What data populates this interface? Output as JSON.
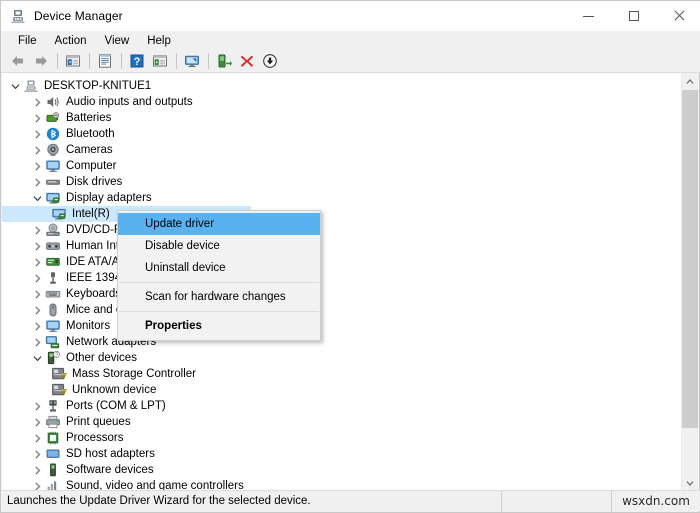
{
  "window": {
    "title": "Device Manager",
    "title_icon": "device-manager-icon",
    "caption": {
      "minimize": "minimize-button",
      "maximize": "maximize-button",
      "close": "close-button"
    }
  },
  "menubar": {
    "items": [
      {
        "label": "File"
      },
      {
        "label": "Action"
      },
      {
        "label": "View"
      },
      {
        "label": "Help"
      }
    ]
  },
  "toolbar": {
    "buttons": [
      {
        "name": "back-button",
        "icon": "back-arrow-icon"
      },
      {
        "name": "forward-button",
        "icon": "forward-arrow-icon"
      },
      {
        "name": "separator-1",
        "icon": "separator"
      },
      {
        "name": "show-hide-console-tree-button",
        "icon": "console-tree-icon"
      },
      {
        "name": "separator-2",
        "icon": "separator"
      },
      {
        "name": "properties-button",
        "icon": "properties-icon"
      },
      {
        "name": "separator-3",
        "icon": "separator"
      },
      {
        "name": "help-button",
        "icon": "help-question-icon"
      },
      {
        "name": "show-hide-action-pane-button",
        "icon": "action-pane-icon"
      },
      {
        "name": "separator-4",
        "icon": "separator"
      },
      {
        "name": "scan-for-hardware-changes-button",
        "icon": "scan-hardware-icon"
      },
      {
        "name": "separator-5",
        "icon": "separator"
      },
      {
        "name": "add-legacy-hardware-button",
        "icon": "add-hardware-icon"
      },
      {
        "name": "uninstall-device-button",
        "icon": "red-x-icon"
      },
      {
        "name": "update-driver-button",
        "icon": "down-arrow-circle-icon"
      }
    ]
  },
  "tree": {
    "nodes": [
      {
        "label": "DESKTOP-KNITUE1",
        "depth": 0,
        "state": "expanded",
        "icon": "computer-root-icon"
      },
      {
        "label": "Audio inputs and outputs",
        "depth": 1,
        "state": "collapsed",
        "icon": "speaker-icon"
      },
      {
        "label": "Batteries",
        "depth": 1,
        "state": "collapsed",
        "icon": "battery-icon"
      },
      {
        "label": "Bluetooth",
        "depth": 1,
        "state": "collapsed",
        "icon": "bluetooth-icon"
      },
      {
        "label": "Cameras",
        "depth": 1,
        "state": "collapsed",
        "icon": "camera-icon"
      },
      {
        "label": "Computer",
        "depth": 1,
        "state": "collapsed",
        "icon": "monitor-icon"
      },
      {
        "label": "Disk drives",
        "depth": 1,
        "state": "collapsed",
        "icon": "disk-drive-icon"
      },
      {
        "label": "Display adapters",
        "depth": 1,
        "state": "expanded",
        "icon": "display-adapter-icon"
      },
      {
        "label": "Intel(R)",
        "depth": 2,
        "state": "leaf",
        "icon": "display-adapter-icon",
        "selected": true
      },
      {
        "label": "DVD/CD-RO",
        "depth": 1,
        "state": "collapsed",
        "icon": "dvd-drive-icon"
      },
      {
        "label": "Human Inte",
        "depth": 1,
        "state": "collapsed",
        "icon": "hid-icon"
      },
      {
        "label": "IDE ATA/AT",
        "depth": 1,
        "state": "collapsed",
        "icon": "ide-controller-icon"
      },
      {
        "label": "IEEE 1394 h",
        "depth": 1,
        "state": "collapsed",
        "icon": "ieee1394-icon"
      },
      {
        "label": "Keyboards",
        "depth": 1,
        "state": "collapsed",
        "icon": "keyboard-icon"
      },
      {
        "label": "Mice and ot",
        "depth": 1,
        "state": "collapsed",
        "icon": "mouse-icon"
      },
      {
        "label": "Monitors",
        "depth": 1,
        "state": "collapsed",
        "icon": "monitor-icon"
      },
      {
        "label": "Network adapters",
        "depth": 1,
        "state": "collapsed",
        "icon": "network-adapter-icon"
      },
      {
        "label": "Other devices",
        "depth": 1,
        "state": "expanded",
        "icon": "other-device-warning-icon"
      },
      {
        "label": "Mass Storage Controller",
        "depth": 2,
        "state": "leaf",
        "icon": "unknown-device-warning-icon"
      },
      {
        "label": "Unknown device",
        "depth": 2,
        "state": "leaf",
        "icon": "unknown-device-warning-icon"
      },
      {
        "label": "Ports (COM & LPT)",
        "depth": 1,
        "state": "collapsed",
        "icon": "port-icon"
      },
      {
        "label": "Print queues",
        "depth": 1,
        "state": "collapsed",
        "icon": "printer-icon"
      },
      {
        "label": "Processors",
        "depth": 1,
        "state": "collapsed",
        "icon": "processor-icon"
      },
      {
        "label": "SD host adapters",
        "depth": 1,
        "state": "collapsed",
        "icon": "sd-adapter-icon"
      },
      {
        "label": "Software devices",
        "depth": 1,
        "state": "collapsed",
        "icon": "software-device-icon"
      },
      {
        "label": "Sound, video and game controllers",
        "depth": 1,
        "state": "collapsed",
        "icon": "sound-controller-icon"
      }
    ]
  },
  "context_menu": {
    "items": [
      {
        "label": "Update driver",
        "highlighted": true,
        "bold": false,
        "type": "item"
      },
      {
        "label": "Disable device",
        "highlighted": false,
        "bold": false,
        "type": "item"
      },
      {
        "label": "Uninstall device",
        "highlighted": false,
        "bold": false,
        "type": "item"
      },
      {
        "type": "separator"
      },
      {
        "label": "Scan for hardware changes",
        "highlighted": false,
        "bold": false,
        "type": "item"
      },
      {
        "type": "separator"
      },
      {
        "label": "Properties",
        "highlighted": false,
        "bold": true,
        "type": "item"
      }
    ]
  },
  "statusbar": {
    "message": "Launches the Update Driver Wizard for the selected device.",
    "watermark": "wsxdn.com"
  },
  "scrollbar": {
    "up_arrow": "scroll-up-arrow",
    "down_arrow": "scroll-down-arrow"
  },
  "colors": {
    "selection": "#cce8ff",
    "menu_highlight": "#5ab1f0",
    "window_bg": "#f0f0f0",
    "pane_bg": "#ffffff"
  }
}
